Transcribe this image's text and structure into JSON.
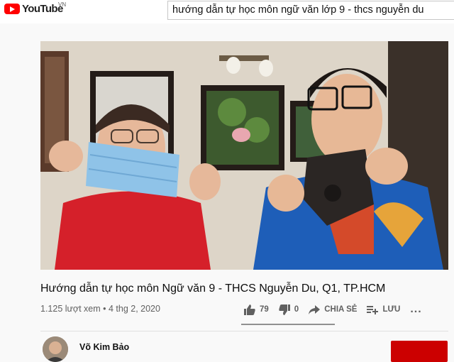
{
  "header": {
    "logo_text": "YouTube",
    "logo_region": "VN",
    "search_value": "hướng dẫn tự học môn ngữ văn lớp 9 - thcs nguyễn du"
  },
  "video": {
    "title": "Hướng dẫn tự học môn Ngữ văn 9 - THCS Nguyễn Du, Q1, TP.HCM",
    "views": "1.125 lượt xem",
    "date": "4 thg 2, 2020",
    "meta_separator": " • ",
    "likes": "79",
    "dislikes": "0",
    "like_ratio": 1.0
  },
  "actions": {
    "share_label": "CHIA SẺ",
    "save_label": "LƯU",
    "more_label": "..."
  },
  "channel": {
    "name": "Võ Kim Bảo"
  },
  "colors": {
    "brand": "#ff0000",
    "subscribe": "#cc0000",
    "text_secondary": "#606060"
  }
}
